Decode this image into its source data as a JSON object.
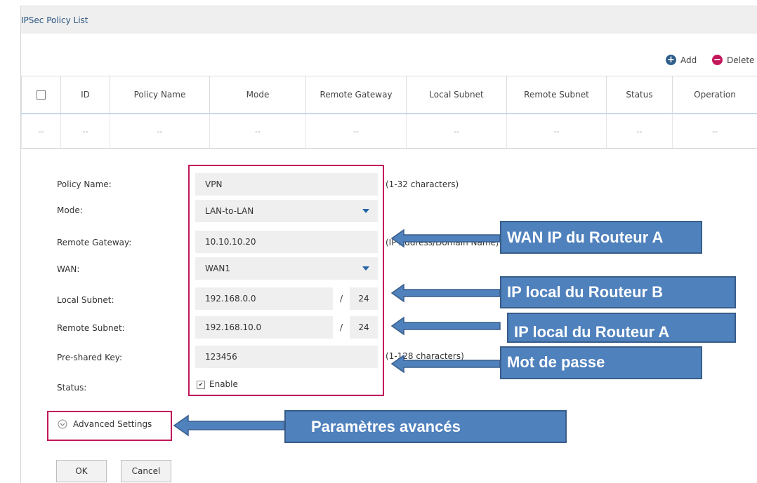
{
  "panel": {
    "title": "IPSec Policy List"
  },
  "toolbar": {
    "add_label": "Add",
    "delete_label": "Delete"
  },
  "table": {
    "columns": [
      "ID",
      "Policy Name",
      "Mode",
      "Remote Gateway",
      "Local Subnet",
      "Remote Subnet",
      "Status",
      "Operation"
    ],
    "empty_row": [
      "--",
      "--",
      "--",
      "--",
      "--",
      "--",
      "--",
      "--",
      "--"
    ]
  },
  "form": {
    "policy_name": {
      "label": "Policy Name:",
      "value": "VPN",
      "hint": "(1-32 characters)"
    },
    "mode": {
      "label": "Mode:",
      "value": "LAN-to-LAN"
    },
    "remote_gateway": {
      "label": "Remote Gateway:",
      "value": "10.10.10.20",
      "hint": "(IP Address/Domain Name)"
    },
    "wan": {
      "label": "WAN:",
      "value": "WAN1"
    },
    "local_subnet": {
      "label": "Local Subnet:",
      "ip": "192.168.0.0",
      "sep": "/",
      "mask": "24"
    },
    "remote_subnet": {
      "label": "Remote Subnet:",
      "ip": "192.168.10.0",
      "sep": "/",
      "mask": "24"
    },
    "preshared_key": {
      "label": "Pre-shared Key:",
      "value": "123456",
      "hint": "(1-128 characters)"
    },
    "status": {
      "label": "Status:",
      "checkbox_label": "Enable",
      "checked": true
    },
    "advanced_label": "Advanced Settings",
    "ok_label": "OK",
    "cancel_label": "Cancel"
  },
  "annotations": {
    "wan_ip_a": "WAN IP du Routeur A",
    "local_ip_b": "IP local du Routeur B",
    "local_ip_a": "IP local du Routeur A",
    "password": "Mot de passe",
    "advanced": "Paramètres avancés"
  },
  "colors": {
    "callout_fill": "#4f81bd",
    "highlight_border": "#c2185b",
    "add_icon": "#2f5f8c",
    "delete_icon": "#c2185b"
  }
}
